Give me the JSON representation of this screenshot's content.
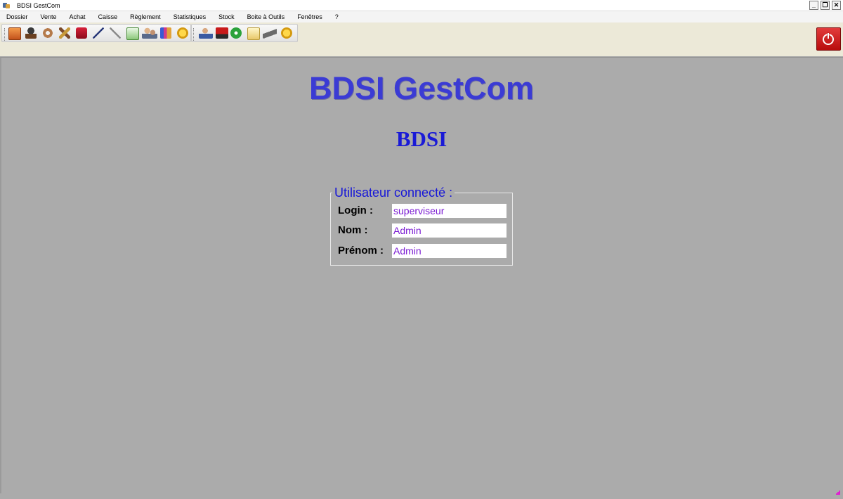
{
  "window": {
    "title": "BDSI GestCom"
  },
  "window_controls": {
    "minimize": "_",
    "restore": "❐",
    "close": "✕"
  },
  "menu": [
    "Dossier",
    "Vente",
    "Achat",
    "Caisse",
    "Règlement",
    "Statistiques",
    "Stock",
    "Boite à Outils",
    "Fenêtres",
    "?"
  ],
  "toolbar_icons": [
    "document-list-icon",
    "user-silhouette-icon",
    "gear-icon",
    "tools-icon",
    "briefcase-icon",
    "pen-icon",
    "pencil-icon",
    "checklist-icon",
    "users-icon",
    "chart-icon",
    "euro-coin-icon",
    "contact-icon",
    "truck-icon",
    "check-icon",
    "note-icon",
    "scanner-icon",
    "euro-coin-icon"
  ],
  "main": {
    "app_title": "BDSI GestCom",
    "company_name": "BDSI"
  },
  "user_panel": {
    "legend": "Utilisateur connecté :",
    "login_label": "Login :",
    "login_value": "superviseur",
    "nom_label": "Nom :",
    "nom_value": "Admin",
    "prenom_label": "Prénom :",
    "prenom_value": "Admin"
  },
  "colors": {
    "background": "#ababab",
    "title": "#3b3bd4",
    "company": "#1a1ad6",
    "field_text": "#7a1ad2",
    "quit_button": "#d12020"
  }
}
